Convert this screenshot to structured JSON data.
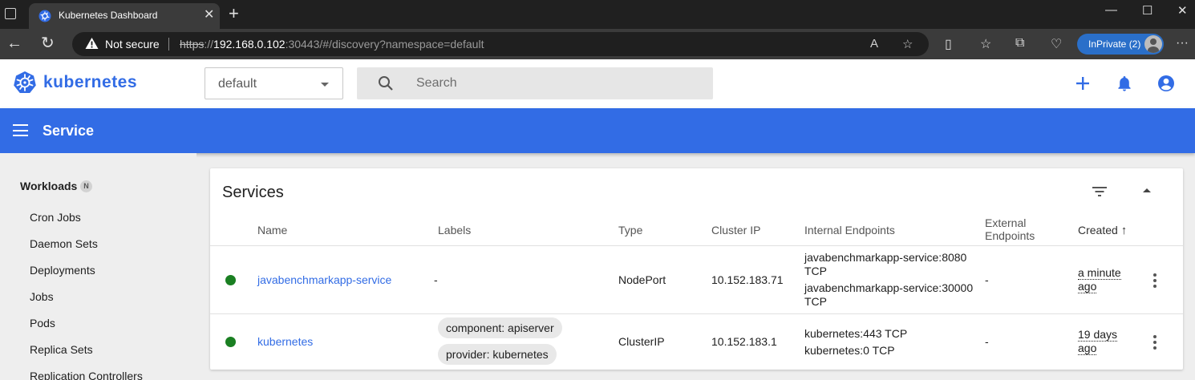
{
  "browser": {
    "tab_title": "Kubernetes Dashboard",
    "security_label": "Not secure",
    "url": {
      "scheme": "https",
      "separator": "://",
      "host": "192.168.0.102",
      "rest": ":30443/#/discovery?namespace=default"
    },
    "inprivate_label": "InPrivate (2)"
  },
  "header": {
    "brand": "kubernetes",
    "namespace": "default",
    "search_placeholder": "Search"
  },
  "toolbar": {
    "title": "Service"
  },
  "sidebar": {
    "section": "Workloads",
    "section_badge": "N",
    "items": [
      "Cron Jobs",
      "Daemon Sets",
      "Deployments",
      "Jobs",
      "Pods",
      "Replica Sets",
      "Replication Controllers"
    ]
  },
  "services": {
    "title": "Services",
    "columns": {
      "name": "Name",
      "labels": "Labels",
      "type": "Type",
      "cluster_ip": "Cluster IP",
      "internal_endpoints": "Internal Endpoints",
      "external_endpoints_1": "External",
      "external_endpoints_2": "Endpoints",
      "created": "Created"
    },
    "sort_indicator": "↑",
    "rows": [
      {
        "status": "running",
        "name": "javabenchmarkapp-service",
        "labels": "-",
        "type": "NodePort",
        "cluster_ip": "10.152.183.71",
        "internal_endpoints": [
          "javabenchmarkapp-service:8080",
          "TCP",
          "javabenchmarkapp-service:30000",
          "TCP"
        ],
        "external_endpoints": "-",
        "created_1": "a minute",
        "created_2": "ago"
      },
      {
        "status": "running",
        "name": "kubernetes",
        "label_chips": [
          "component: apiserver",
          "provider: kubernetes"
        ],
        "type": "ClusterIP",
        "cluster_ip": "10.152.183.1",
        "internal_endpoints": [
          "kubernetes:443 TCP",
          "kubernetes:0 TCP"
        ],
        "external_endpoints": "-",
        "created_1": "19 days",
        "created_2": "ago"
      }
    ]
  },
  "colors": {
    "brand_blue": "#326ce5",
    "status_green": "#1a7f22",
    "edge_inprivate": "#2a6fc9"
  }
}
